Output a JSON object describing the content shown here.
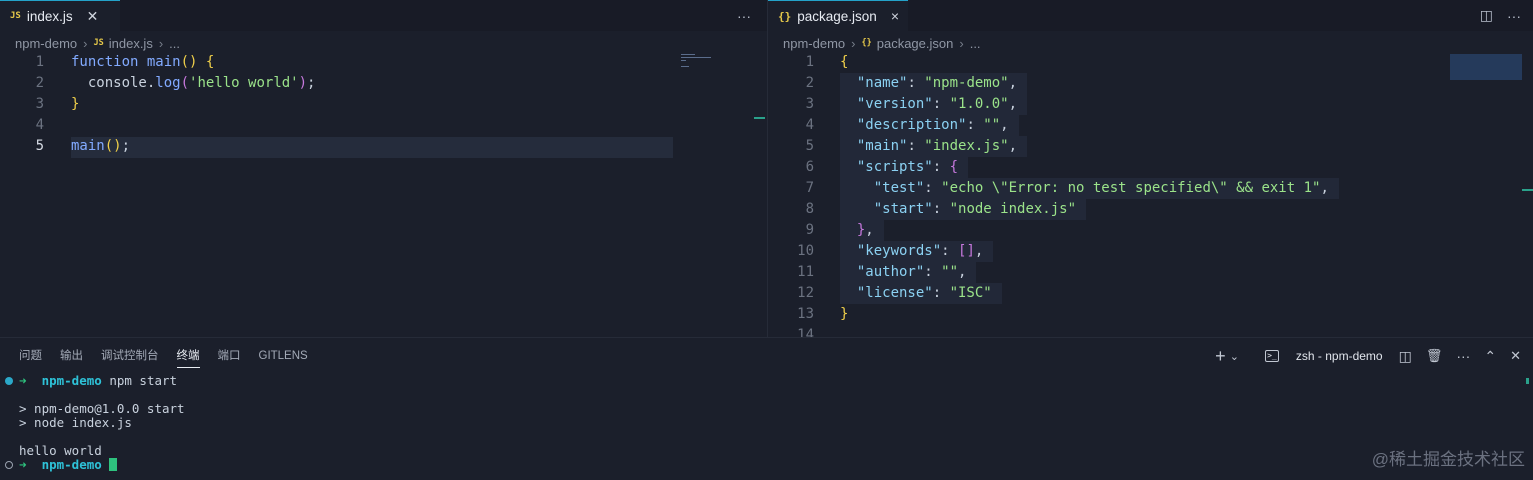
{
  "left_editor": {
    "tab_icon": "JS",
    "tab_label": "index.js",
    "more_icon": "ellipsis-icon",
    "breadcrumb": {
      "folder": "npm-demo",
      "file_icon": "JS",
      "file": "index.js",
      "tail": "..."
    },
    "lines": [
      {
        "n": "1",
        "tokens": [
          [
            "kw",
            "function"
          ],
          [
            "pl",
            " "
          ],
          [
            "fn",
            "main"
          ],
          [
            "pr",
            "()"
          ],
          [
            "pl",
            " "
          ],
          [
            "pr",
            "{"
          ]
        ]
      },
      {
        "n": "2",
        "tokens": [
          [
            "pl",
            "  console."
          ],
          [
            "fn",
            "log"
          ],
          [
            "br",
            "("
          ],
          [
            "str",
            "'hello world'"
          ],
          [
            "br",
            ")"
          ],
          [
            "pl",
            ";"
          ]
        ]
      },
      {
        "n": "3",
        "tokens": [
          [
            "pr",
            "}"
          ]
        ]
      },
      {
        "n": "4",
        "tokens": []
      },
      {
        "n": "5",
        "tokens": [
          [
            "fn",
            "main"
          ],
          [
            "pr",
            "()"
          ],
          [
            "pl",
            ";"
          ]
        ]
      }
    ]
  },
  "right_editor": {
    "tab_icon": "{}",
    "tab_label": "package.json",
    "close_icon": "×",
    "breadcrumb": {
      "folder": "npm-demo",
      "file_icon": "{}",
      "file": "package.json",
      "tail": "..."
    },
    "lines": [
      {
        "n": "1",
        "tokens": [
          [
            "pr",
            "{"
          ]
        ]
      },
      {
        "n": "2",
        "tokens": [
          [
            "pl",
            "  "
          ],
          [
            "key",
            "\"name\""
          ],
          [
            "punc",
            ": "
          ],
          [
            "str",
            "\"npm-demo\""
          ],
          [
            "punc",
            ","
          ]
        ]
      },
      {
        "n": "3",
        "tokens": [
          [
            "pl",
            "  "
          ],
          [
            "key",
            "\"version\""
          ],
          [
            "punc",
            ": "
          ],
          [
            "str",
            "\"1.0.0\""
          ],
          [
            "punc",
            ","
          ]
        ]
      },
      {
        "n": "4",
        "tokens": [
          [
            "pl",
            "  "
          ],
          [
            "key",
            "\"description\""
          ],
          [
            "punc",
            ": "
          ],
          [
            "str",
            "\"\""
          ],
          [
            "punc",
            ","
          ]
        ]
      },
      {
        "n": "5",
        "tokens": [
          [
            "pl",
            "  "
          ],
          [
            "key",
            "\"main\""
          ],
          [
            "punc",
            ": "
          ],
          [
            "str",
            "\"index.js\""
          ],
          [
            "punc",
            ","
          ]
        ]
      },
      {
        "n": "6",
        "tokens": [
          [
            "pl",
            "  "
          ],
          [
            "key",
            "\"scripts\""
          ],
          [
            "punc",
            ": "
          ],
          [
            "br",
            "{"
          ]
        ]
      },
      {
        "n": "7",
        "tokens": [
          [
            "pl",
            "    "
          ],
          [
            "key",
            "\"test\""
          ],
          [
            "punc",
            ": "
          ],
          [
            "str",
            "\"echo \\\"Error: no test specified\\\" && exit 1\""
          ],
          [
            "punc",
            ","
          ]
        ]
      },
      {
        "n": "8",
        "tokens": [
          [
            "pl",
            "    "
          ],
          [
            "key",
            "\"start\""
          ],
          [
            "punc",
            ": "
          ],
          [
            "str",
            "\"node index.js\""
          ]
        ]
      },
      {
        "n": "9",
        "tokens": [
          [
            "pl",
            "  "
          ],
          [
            "br",
            "}"
          ],
          [
            "punc",
            ","
          ]
        ]
      },
      {
        "n": "10",
        "tokens": [
          [
            "pl",
            "  "
          ],
          [
            "key",
            "\"keywords\""
          ],
          [
            "punc",
            ": "
          ],
          [
            "br",
            "[]"
          ],
          [
            "punc",
            ","
          ]
        ]
      },
      {
        "n": "11",
        "tokens": [
          [
            "pl",
            "  "
          ],
          [
            "key",
            "\"author\""
          ],
          [
            "punc",
            ": "
          ],
          [
            "str",
            "\"\""
          ],
          [
            "punc",
            ","
          ]
        ]
      },
      {
        "n": "12",
        "tokens": [
          [
            "pl",
            "  "
          ],
          [
            "key",
            "\"license\""
          ],
          [
            "punc",
            ": "
          ],
          [
            "str",
            "\"ISC\""
          ]
        ]
      },
      {
        "n": "13",
        "tokens": [
          [
            "pr",
            "}"
          ]
        ]
      },
      {
        "n": "14",
        "tokens": []
      }
    ]
  },
  "panel": {
    "tabs": [
      "问题",
      "输出",
      "调试控制台",
      "终端",
      "端口",
      "GITLENS"
    ],
    "active_tab": "终端",
    "terminal_name": "zsh - npm-demo",
    "actions": {
      "add": "+",
      "dropdown": "⌄",
      "split": "◫",
      "trash": "🗑",
      "more": "···",
      "maximize": "⌃",
      "close": "✕"
    }
  },
  "terminal": {
    "lines": [
      {
        "dot": "filled",
        "arrow": "➜",
        "dir": "npm-demo",
        "rest": " npm start"
      },
      {
        "text": ""
      },
      {
        "text": "> npm-demo@1.0.0 start"
      },
      {
        "text": "> node index.js"
      },
      {
        "text": ""
      },
      {
        "text": "hello world"
      },
      {
        "dot": "hollow",
        "arrow": "➜",
        "dir": "npm-demo",
        "rest": " ",
        "cursor": true
      }
    ]
  },
  "watermark": "@稀土掘金技术社区",
  "colors": {
    "accent": "#24a2c9",
    "string": "#9be38a",
    "keyword": "#82aaff",
    "json_key": "#8bd1f2",
    "bracket": "#f0d04a"
  }
}
